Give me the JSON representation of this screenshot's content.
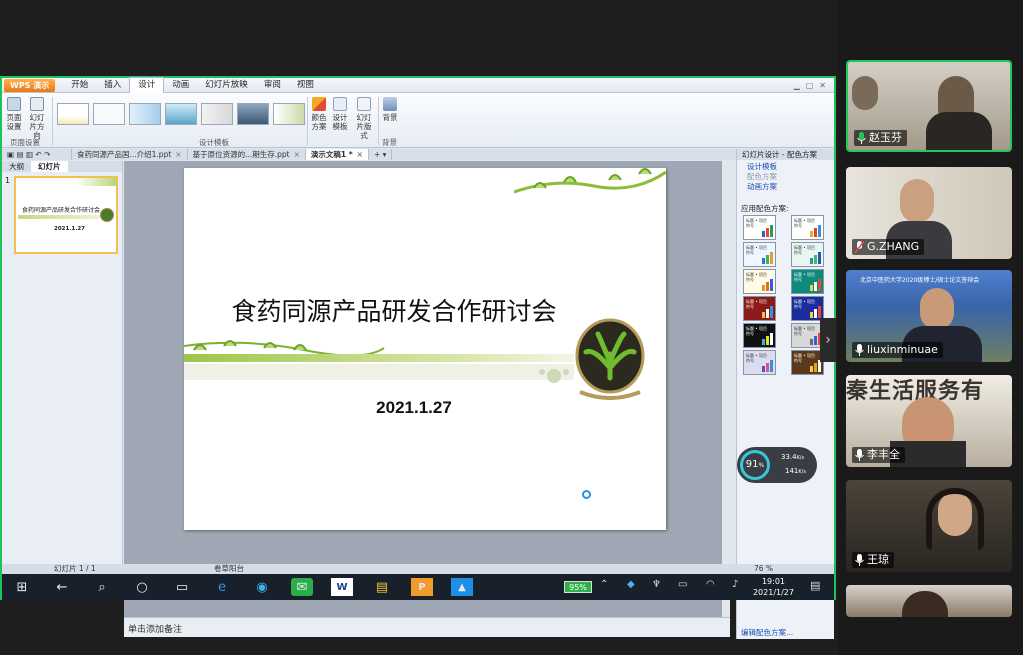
{
  "app": {
    "logo": "WPS 演示",
    "menu": [
      "开始",
      "插入",
      "设计",
      "动画",
      "幻灯片放映",
      "审阅",
      "视图"
    ],
    "active_menu": "设计"
  },
  "ribbon": {
    "page_setup": "页面设置",
    "slide_direction": "幻灯片方向",
    "page_setup_group": "页面设置",
    "design_templates_group": "设计模板",
    "color_scheme": "颜色方案",
    "design_template": "设计模板",
    "slide_layout": "幻灯片版式",
    "background": "背景",
    "background_group": "背景"
  },
  "tabs": [
    {
      "label": "食药同源产品国...介绍1.ppt",
      "active": false
    },
    {
      "label": "基于原位资源的...期生存.ppt",
      "active": false
    },
    {
      "label": "演示文稿1 *",
      "active": true
    }
  ],
  "left_panel": {
    "tabs": [
      "大纲",
      "幻灯片"
    ],
    "slide_number": "1",
    "thumb_title": "食药同源产品研发合作研讨会",
    "thumb_date": "2021.1.27"
  },
  "slide": {
    "title": "食药同源产品研发合作研讨会",
    "date": "2021.1.27"
  },
  "notes_placeholder": "单击添加备注",
  "right_panel": {
    "header": "幻灯片设计 - 配色方案",
    "links": [
      "设计模板",
      "配色方案",
      "动画方案"
    ],
    "apply_label": "应用配色方案:",
    "edit_label": "编辑配色方案...",
    "scheme_text": "标题 • 项目符号",
    "schemes": [
      {
        "bg": "#ffffff",
        "bars": [
          "#3a5bd9",
          "#e24b2f",
          "#2e9a4f"
        ]
      },
      {
        "bg": "#ffffff",
        "bars": [
          "#e4b21c",
          "#d9432b",
          "#3a8fd9"
        ]
      },
      {
        "bg": "#eef6ff",
        "bars": [
          "#2e6fd9",
          "#3fb34f",
          "#e2a02b"
        ]
      },
      {
        "bg": "#e9f5f0",
        "bars": [
          "#2e9a8a",
          "#4fb36e",
          "#1f5ca8"
        ]
      },
      {
        "bg": "#fffbe6",
        "bars": [
          "#d99a1c",
          "#e26a2f",
          "#3a5bd9"
        ]
      },
      {
        "bg": "#0c8a7c",
        "bars": [
          "#f2d13a",
          "#ffffff",
          "#e24b2f"
        ]
      },
      {
        "bg": "#8b1a1a",
        "bars": [
          "#f2c23a",
          "#ffffff",
          "#3a8fd9"
        ]
      },
      {
        "bg": "#1a2d9a",
        "bars": [
          "#f2d13a",
          "#ffffff",
          "#e24b2f"
        ]
      },
      {
        "bg": "#111111",
        "bars": [
          "#3fb3d9",
          "#e2e22b",
          "#ffffff"
        ]
      },
      {
        "bg": "#d8d8d8",
        "bars": [
          "#6a6a6a",
          "#3a5bd9",
          "#e24b2f"
        ]
      },
      {
        "bg": "#dcdcf0",
        "bars": [
          "#5a4fb3",
          "#e24b8f",
          "#3a8fd9"
        ]
      },
      {
        "bg": "#5a3a1a",
        "bars": [
          "#f2d13a",
          "#e2a02b",
          "#ffffff"
        ]
      }
    ]
  },
  "status_bar": {
    "slide_count": "幻灯片 1 / 1",
    "template": "卷草阳台",
    "zoom": "76 %"
  },
  "net_widget": {
    "percent": "91",
    "percent_unit": "%",
    "up": "33.4",
    "up_unit": "K/s",
    "down": "141",
    "down_unit": "K/s"
  },
  "taskbar": {
    "battery": "95%",
    "time": "19:01",
    "date": "2021/1/27"
  },
  "participants": [
    {
      "name": "赵玉芬",
      "muted": false,
      "speaking": true,
      "bg": "#b9b3a6"
    },
    {
      "name": "G.ZHANG",
      "muted": true,
      "speaking": false,
      "bg": "#c9c2b3"
    },
    {
      "name": "liuxinminuae",
      "muted": false,
      "speaking": false,
      "bg": "#6f8db3",
      "banner": "北京中医药大学2020级博士/硕士论文答辩会"
    },
    {
      "name": "李丰全",
      "muted": false,
      "speaking": false,
      "bg": "#8b7d6e",
      "overlay_text": "秦生活服务有"
    },
    {
      "name": "王琼",
      "muted": false,
      "speaking": false,
      "bg": "#3b3630"
    }
  ],
  "colors": {
    "speaking_border": "#22c55e",
    "share_border": "#1ec25a",
    "wps_orange": "#e9761b"
  }
}
